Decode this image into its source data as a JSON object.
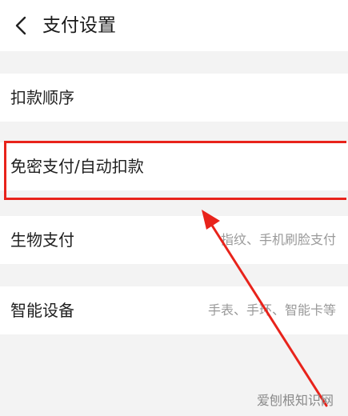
{
  "header": {
    "back_icon": "chevron-left-icon",
    "title": "支付设置"
  },
  "rows": [
    {
      "label": "扣款顺序",
      "hint": ""
    },
    {
      "label": "免密支付/自动扣款",
      "hint": ""
    },
    {
      "label": "生物支付",
      "hint": "指纹、手机刷脸支付"
    },
    {
      "label": "智能设备",
      "hint": "手表、手环、智能卡等"
    }
  ],
  "annotation": {
    "color": "#e8231b"
  },
  "watermark": "爱刨根知识网"
}
